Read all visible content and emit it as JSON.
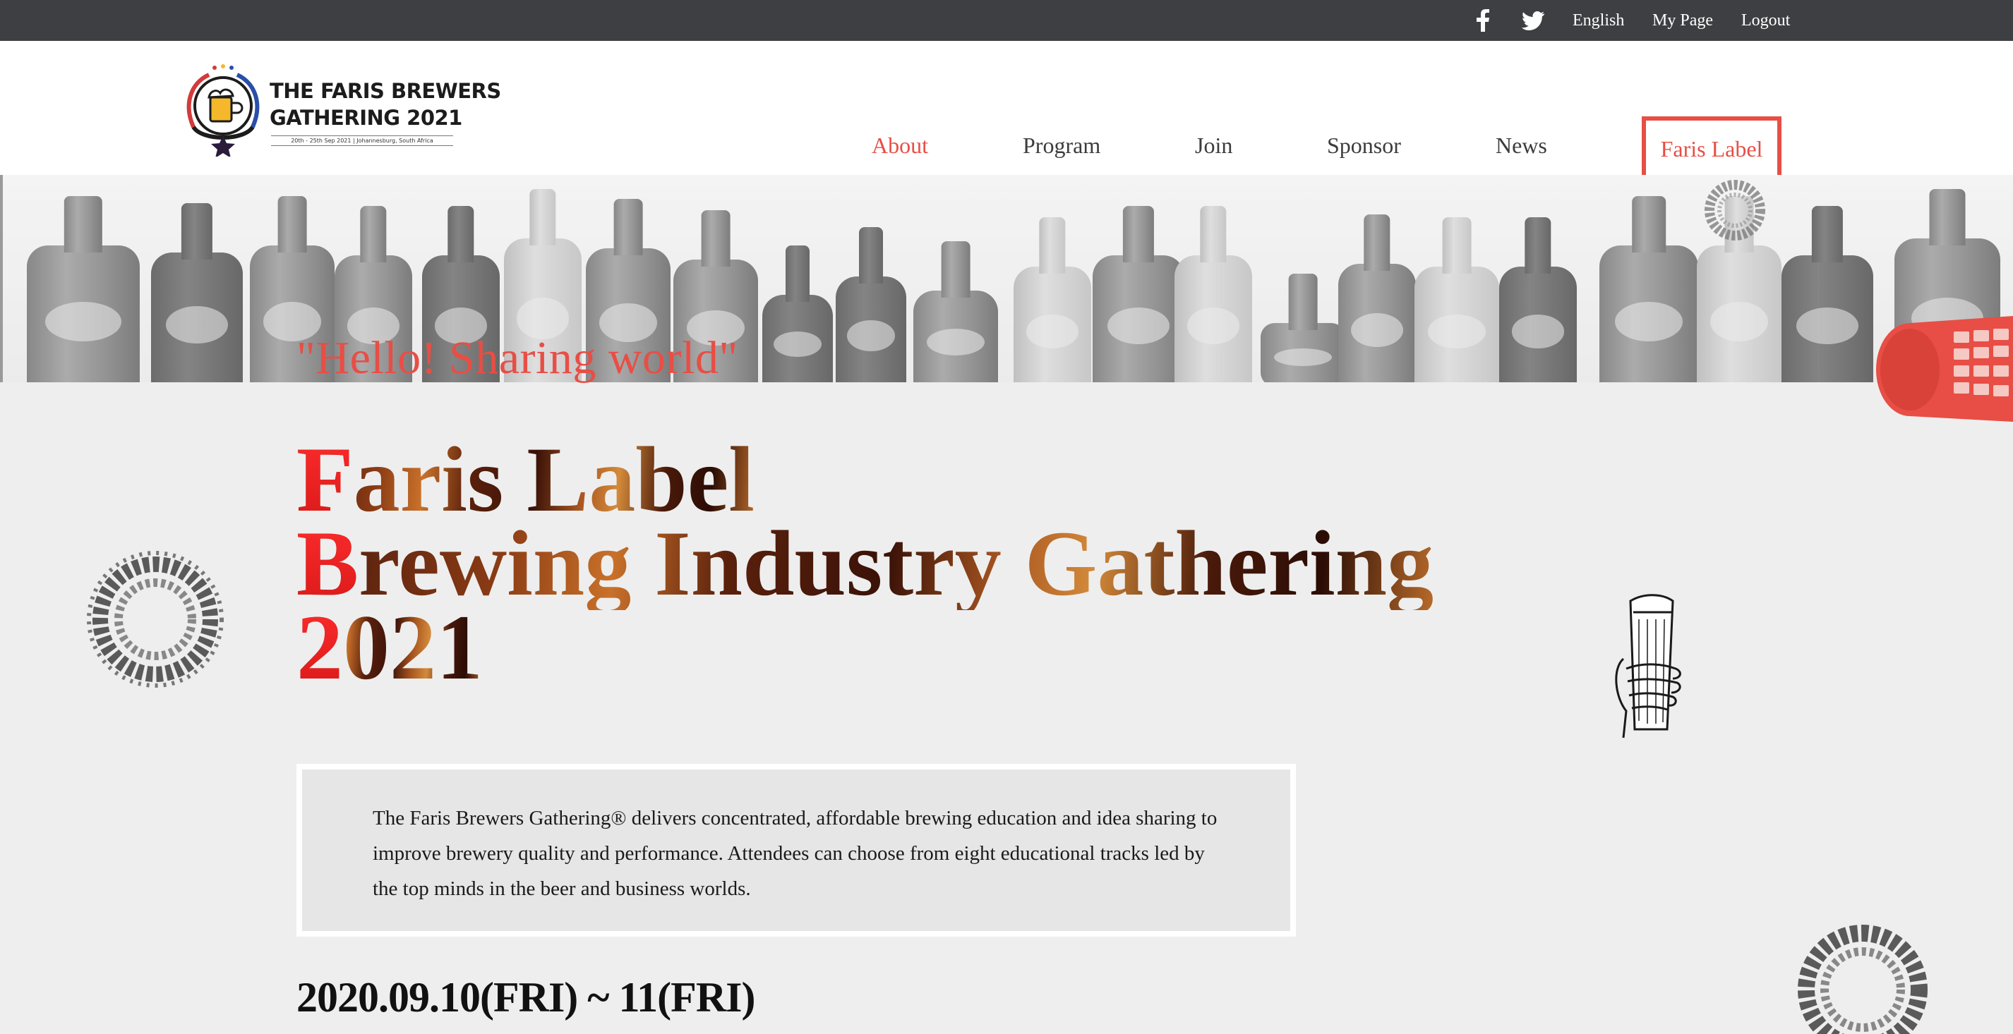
{
  "topbar": {
    "facebook_icon": "facebook-icon",
    "twitter_icon": "twitter-icon",
    "language": "English",
    "my_page": "My Page",
    "logout": "Logout"
  },
  "logo": {
    "line1": "THE FARIS BREWERS",
    "line2": "GATHERING 2021",
    "sub": "20th - 25th Sep 2021 | Johannesburg, South Africa"
  },
  "nav": {
    "items": [
      {
        "label": "About",
        "active": true
      },
      {
        "label": "Program",
        "active": false
      },
      {
        "label": "Join",
        "active": false
      },
      {
        "label": "Sponsor",
        "active": false
      },
      {
        "label": "News",
        "active": false
      }
    ],
    "cta": "Faris Label"
  },
  "hero": {
    "tagline": "\"Hello! Sharing world\"",
    "title_lines": [
      {
        "first": "F",
        "rest": "aris Label"
      },
      {
        "first": "B",
        "rest": "rewing Industry Gathering"
      },
      {
        "first": "2",
        "rest": "021"
      }
    ],
    "description": "The Faris Brewers Gathering® delivers concentrated, affordable brewing education and idea sharing to improve brewery quality and performance. Attendees can choose from eight educational tracks led by the top minds in the beer and business worlds.",
    "date": "2020.09.10(FRI) ~ 11(FRI)"
  },
  "colors": {
    "accent": "#e84e45",
    "topbar": "#3e3f43",
    "page_bg": "#eeeeee"
  }
}
